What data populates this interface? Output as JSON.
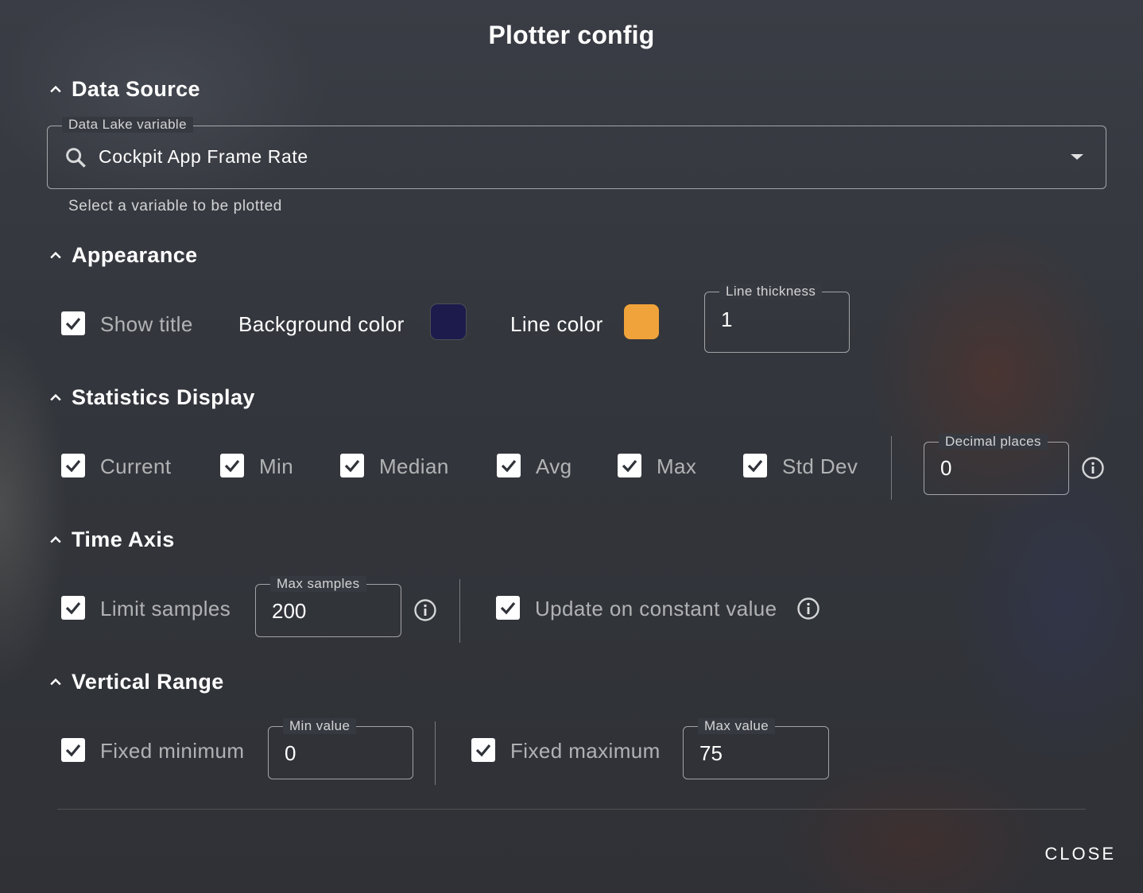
{
  "dialog": {
    "title": "Plotter config",
    "close_label": "CLOSE"
  },
  "data_source": {
    "header": "Data Source",
    "variable_label": "Data Lake variable",
    "variable_value": "Cockpit App Frame Rate",
    "hint": "Select a variable to be plotted"
  },
  "appearance": {
    "header": "Appearance",
    "show_title_label": "Show title",
    "show_title_checked": true,
    "background_color_label": "Background color",
    "background_color": "#1c1b4c",
    "line_color_label": "Line color",
    "line_color": "#f0a33a",
    "line_thickness_label": "Line thickness",
    "line_thickness_value": "1"
  },
  "statistics": {
    "header": "Statistics Display",
    "items": [
      {
        "label": "Current",
        "checked": true
      },
      {
        "label": "Min",
        "checked": true
      },
      {
        "label": "Median",
        "checked": true
      },
      {
        "label": "Avg",
        "checked": true
      },
      {
        "label": "Max",
        "checked": true
      },
      {
        "label": "Std Dev",
        "checked": true
      }
    ],
    "decimal_places_label": "Decimal places",
    "decimal_places_value": "0"
  },
  "time_axis": {
    "header": "Time Axis",
    "limit_samples_label": "Limit samples",
    "max_samples_label": "Max samples",
    "max_samples_value": "200",
    "update_constant_label": "Update on constant value"
  },
  "vertical_range": {
    "header": "Vertical Range",
    "fixed_min_label": "Fixed minimum",
    "min_value_label": "Min value",
    "min_value": "0",
    "fixed_max_label": "Fixed maximum",
    "max_value_label": "Max value",
    "max_value": "75"
  }
}
